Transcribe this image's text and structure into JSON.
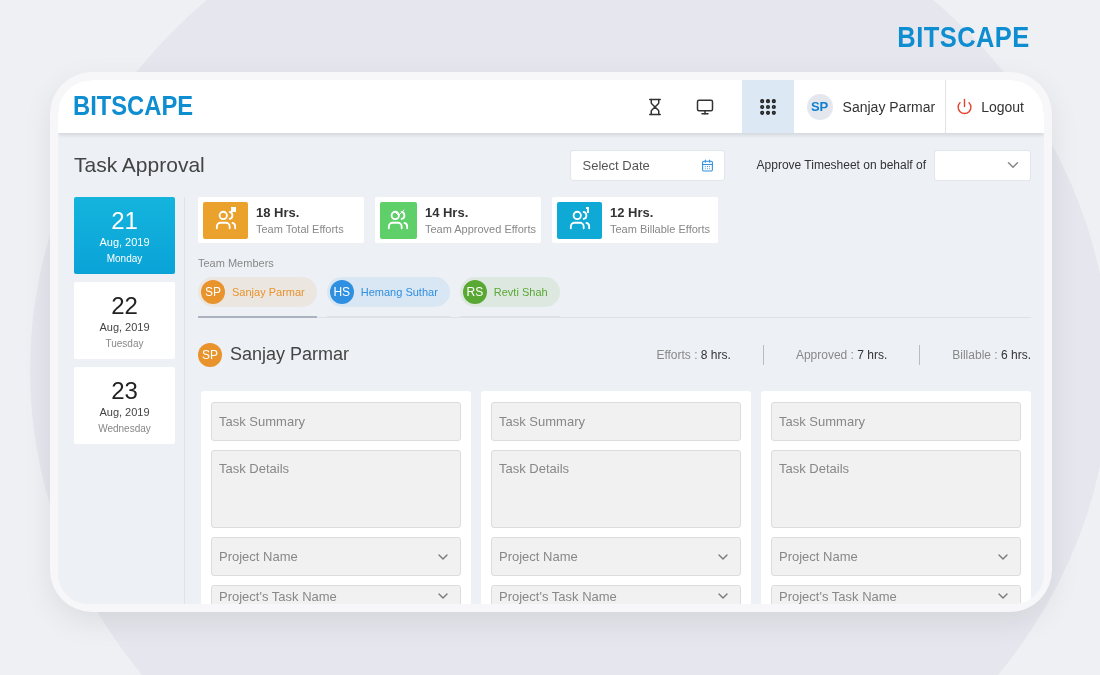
{
  "brand": "BITSCAPE",
  "header": {
    "logo": "BITSCAPE",
    "icons": [
      {
        "kind": "hourglass",
        "selected": false
      },
      {
        "kind": "monitor",
        "selected": false
      },
      {
        "kind": "apps",
        "selected": true
      }
    ],
    "user": {
      "initials": "SP",
      "name": "Sanjay Parmar"
    },
    "logout": "Logout"
  },
  "page": {
    "title": "Task Approval",
    "date_field": {
      "placeholder": "Select Date"
    },
    "behalf_label": "Approve Timesheet on behalf of"
  },
  "dates": [
    {
      "day": "21",
      "month": "Aug, 2019",
      "weekday": "Monday",
      "selected": true
    },
    {
      "day": "22",
      "month": "Aug, 2019",
      "weekday": "Tuesday",
      "selected": false
    },
    {
      "day": "23",
      "month": "Aug, 2019",
      "weekday": "Wednesday",
      "selected": false
    }
  ],
  "stats": [
    {
      "kind": "total",
      "value": "18 Hrs.",
      "label": "Team Total Efforts",
      "color": "#eba22c"
    },
    {
      "kind": "approved",
      "value": "14 Hrs.",
      "label": "Team Approved Efforts",
      "color": "#5fcf6a"
    },
    {
      "kind": "billable",
      "value": "12 Hrs.",
      "label": "Team Billable Efforts",
      "color": "#0fa9d6"
    }
  ],
  "team_label": "Team Members",
  "members": [
    {
      "initials": "SP",
      "name": "Sanjay Parmar",
      "color": "#e8932c",
      "selected": true
    },
    {
      "initials": "HS",
      "name": "Hemang Suthar",
      "color": "#2f8fe0",
      "selected": false
    },
    {
      "initials": "RS",
      "name": "Revti Shah",
      "color": "#5aa834",
      "selected": false
    }
  ],
  "member_detail": {
    "initials": "SP",
    "name": "Sanjay Parmar",
    "color": "#e8932c",
    "stats": [
      {
        "label": "Efforts :",
        "value": "8 hrs."
      },
      {
        "label": "Approved :",
        "value": "7 hrs."
      },
      {
        "label": "Billable :",
        "value": "6 hrs."
      }
    ]
  },
  "task_cards": [
    {
      "fields": [
        {
          "kind": "input",
          "placeholder": "Task Summary"
        },
        {
          "kind": "textarea",
          "placeholder": "Task Details"
        },
        {
          "kind": "select",
          "placeholder": "Project Name"
        },
        {
          "kind": "select",
          "placeholder": "Project's Task Name"
        }
      ]
    },
    {
      "fields": [
        {
          "kind": "input",
          "placeholder": "Task Summary"
        },
        {
          "kind": "textarea",
          "placeholder": "Task Details"
        },
        {
          "kind": "select",
          "placeholder": "Project Name"
        },
        {
          "kind": "select",
          "placeholder": "Project's Task Name"
        }
      ]
    },
    {
      "fields": [
        {
          "kind": "input",
          "placeholder": "Task Summary"
        },
        {
          "kind": "textarea",
          "placeholder": "Task Details"
        },
        {
          "kind": "select",
          "placeholder": "Project Name"
        },
        {
          "kind": "select",
          "placeholder": "Project's Task Name"
        }
      ]
    }
  ]
}
